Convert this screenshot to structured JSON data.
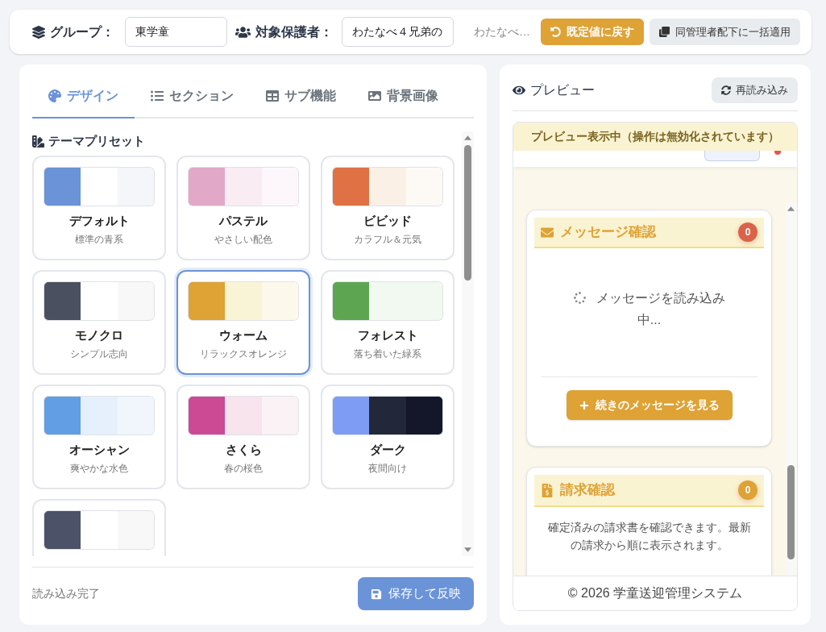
{
  "toolbar": {
    "group_label": "グループ：",
    "group_value": "東学童",
    "guardian_label": "対象保護者：",
    "guardian_value": "わたなべ４兄弟の",
    "guardian_name": "わたなべ…",
    "buttons": [
      {
        "label": "既定値に戻す",
        "kind": "primary"
      },
      {
        "label": "同管理者配下に一括適用",
        "kind": "secondary"
      }
    ]
  },
  "editor": {
    "tabs": [
      {
        "label": "デザイン",
        "selected": true
      },
      {
        "label": "セクション",
        "selected": false
      },
      {
        "label": "サブ機能",
        "selected": false
      },
      {
        "label": "背景画像",
        "selected": false
      }
    ],
    "section_title": "テーマプリセット",
    "presets": [
      {
        "name": "デフォルト",
        "description": "標準の青系",
        "swatches": [
          {
            "color": "#6a93d8"
          },
          {
            "color": "#ffffff"
          },
          {
            "color": "#f4f6fa"
          }
        ],
        "selected": false
      },
      {
        "name": "パステル",
        "description": "やさしい配色",
        "swatches": [
          {
            "color": "#e2a8c8"
          },
          {
            "color": "#f9ecf3"
          },
          {
            "color": "#fdf7fb"
          }
        ],
        "selected": false
      },
      {
        "name": "ビビッド",
        "description": "カラフル＆元気",
        "swatches": [
          {
            "color": "#e07144"
          },
          {
            "color": "#faf0e6"
          },
          {
            "color": "#fdfaf5"
          }
        ],
        "selected": false
      },
      {
        "name": "モノクロ",
        "description": "シンプル志向",
        "swatches": [
          {
            "color": "#4a5060"
          },
          {
            "color": "#ffffff"
          },
          {
            "color": "#f8f8f8"
          }
        ],
        "selected": false
      },
      {
        "name": "ウォーム",
        "description": "リラックスオレンジ",
        "swatches": [
          {
            "color": "#dea235"
          },
          {
            "color": "#faf4d6"
          },
          {
            "color": "#fcf9ec"
          }
        ],
        "selected": true
      },
      {
        "name": "フォレスト",
        "description": "落ち着いた緑系",
        "swatches": [
          {
            "color": "#5ea552"
          },
          {
            "color": "#f2f9f1"
          },
          {
            "color": "#f2f9f1"
          }
        ],
        "selected": false
      },
      {
        "name": "オーシャン",
        "description": "爽やかな水色",
        "swatches": [
          {
            "color": "#619ee4"
          },
          {
            "color": "#e6f0fc"
          },
          {
            "color": "#f1f6fd"
          }
        ],
        "selected": false
      },
      {
        "name": "さくら",
        "description": "春の桜色",
        "swatches": [
          {
            "color": "#cc4994"
          },
          {
            "color": "#f7e4ec"
          },
          {
            "color": "#faf2f5"
          }
        ],
        "selected": false
      },
      {
        "name": "ダーク",
        "description": "夜間向け",
        "swatches": [
          {
            "color": "#7f9cf5"
          },
          {
            "color": "#23273a"
          },
          {
            "color": "#14172a"
          }
        ],
        "selected": false
      },
      {
        "swatches": [
          {
            "color": "#4c5268"
          },
          {
            "color": "#ffffff"
          },
          {
            "color": "#f8f8f8"
          }
        ],
        "selected": false
      }
    ],
    "status": "読み込み完了",
    "save_button": "保存して反映"
  },
  "preview": {
    "title": "プレビュー",
    "reload_button": "再読み込み",
    "banner": "プレビュー表示中（操作は無効化されています）",
    "cards": [
      {
        "kind": "messages",
        "title": "メッセージ確認",
        "badge": "0",
        "color": "#d9634a",
        "loading_text": "メッセージを読み込み中...",
        "more_button": "続きのメッセージを見る"
      },
      {
        "kind": "billing",
        "title": "請求確認",
        "badge": "0",
        "color": "#dea235",
        "text": "確定済みの請求書を確認できます。最新の請求から順に表示されます。"
      }
    ],
    "footer": "© 2026 学童送迎管理システム"
  }
}
